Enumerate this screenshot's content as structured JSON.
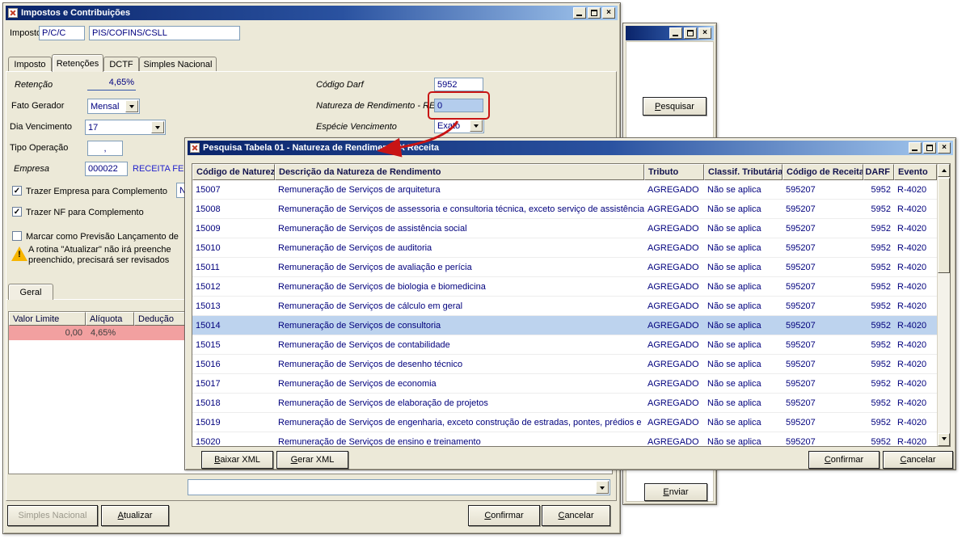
{
  "icons": {
    "close": "×",
    "check": "✓",
    "warning_mark": "!"
  },
  "colors": {
    "titlebar_start": "#0A246A",
    "titlebar_end": "#A6CAF0",
    "selected_row": "#BDD3EE",
    "limit_row": "#F2A0A0",
    "annotation_red": "#C81414",
    "field_text": "#000080"
  },
  "main_window": {
    "title": "Impostos e Contribuições",
    "imposto": {
      "label": "Imposto",
      "code": "P/C/C",
      "name": "PIS/COFINS/CSLL"
    },
    "tabs": [
      "Imposto",
      "Retenções",
      "DCTF",
      "Simples Nacional"
    ],
    "active_tab": "Retenções",
    "ret": {
      "retencao_label": "Retenção",
      "retencao_value": "4,65%",
      "fato_label": "Fato Gerador",
      "fato_value": "Mensal",
      "dia_label": "Dia Vencimento",
      "dia_value": "17",
      "tipo_label": "Tipo Operação",
      "tipo_value": ",",
      "empresa_label": "Empresa",
      "empresa_code": "000022",
      "empresa_name": "RECEITA FEDE",
      "check1": "Trazer Empresa para Complemento",
      "check1_value": "N",
      "check2": "Trazer NF para Complemento",
      "check3": "Marcar como Previsão Lançamento de",
      "warn1": "A rotina \"Atualizar\" não irá preenche",
      "warn2": "preenchido, precisará ser revisados",
      "darf_label": "Código Darf",
      "darf_value": "5952",
      "natureza_label": "Natureza de Rendimento - REINF",
      "natureza_value": "0",
      "especie_label": "Espécie Vencimento",
      "especie_value": "Exato"
    },
    "geral": {
      "tab": "Geral",
      "headers": [
        "Valor Limite",
        "Alíquota",
        "Dedução"
      ],
      "valor": "0,00",
      "aliquota": "4,65%"
    },
    "buttons": {
      "simples": "Simples Nacional",
      "atualizar": "Atualizar",
      "confirmar": "Confirmar",
      "cancelar": "Cancelar"
    }
  },
  "back_window": {
    "pesquisar": "Pesquisar",
    "enviar": "Enviar"
  },
  "popup": {
    "title": "Pesquisa Tabela 01 - Natureza de Rendimento X Receita",
    "columns": [
      "Código de Natureza",
      "Descrição da Natureza de Rendimento",
      "Tributo",
      "Classif. Tributária",
      "Código de Receita",
      "DARF",
      "Evento"
    ],
    "selected_code": "15014",
    "rows": [
      {
        "code": "15007",
        "desc": "Remuneração de Serviços de arquitetura",
        "tributo": "AGREGADO",
        "classif": "Não se aplica",
        "receita": "595207",
        "darf": "5952",
        "evento": "R-4020"
      },
      {
        "code": "15008",
        "desc": "Remuneração de Serviços de assessoria e consultoria técnica, exceto serviço de assistência técnica",
        "tributo": "AGREGADO",
        "classif": "Não se aplica",
        "receita": "595207",
        "darf": "5952",
        "evento": "R-4020"
      },
      {
        "code": "15009",
        "desc": "Remuneração de Serviços de assistência social",
        "tributo": "AGREGADO",
        "classif": "Não se aplica",
        "receita": "595207",
        "darf": "5952",
        "evento": "R-4020"
      },
      {
        "code": "15010",
        "desc": "Remuneração de Serviços de auditoria",
        "tributo": "AGREGADO",
        "classif": "Não se aplica",
        "receita": "595207",
        "darf": "5952",
        "evento": "R-4020"
      },
      {
        "code": "15011",
        "desc": "Remuneração de Serviços de avaliação e perícia",
        "tributo": "AGREGADO",
        "classif": "Não se aplica",
        "receita": "595207",
        "darf": "5952",
        "evento": "R-4020"
      },
      {
        "code": "15012",
        "desc": "Remuneração de Serviços de  biologia e biomedicina",
        "tributo": "AGREGADO",
        "classif": "Não se aplica",
        "receita": "595207",
        "darf": "5952",
        "evento": "R-4020"
      },
      {
        "code": "15013",
        "desc": "Remuneração de Serviços de cálculo em geral",
        "tributo": "AGREGADO",
        "classif": "Não se aplica",
        "receita": "595207",
        "darf": "5952",
        "evento": "R-4020"
      },
      {
        "code": "15014",
        "desc": "Remuneração de Serviços de consultoria",
        "tributo": "AGREGADO",
        "classif": "Não se aplica",
        "receita": "595207",
        "darf": "5952",
        "evento": "R-4020"
      },
      {
        "code": "15015",
        "desc": "Remuneração de Serviços de  contabilidade",
        "tributo": "AGREGADO",
        "classif": "Não se aplica",
        "receita": "595207",
        "darf": "5952",
        "evento": "R-4020"
      },
      {
        "code": "15016",
        "desc": "Remuneração de Serviços de desenho técnico",
        "tributo": "AGREGADO",
        "classif": "Não se aplica",
        "receita": "595207",
        "darf": "5952",
        "evento": "R-4020"
      },
      {
        "code": "15017",
        "desc": "Remuneração de Serviços de economia",
        "tributo": "AGREGADO",
        "classif": "Não se aplica",
        "receita": "595207",
        "darf": "5952",
        "evento": "R-4020"
      },
      {
        "code": "15018",
        "desc": "Remuneração de Serviços de elaboração de projetos",
        "tributo": "AGREGADO",
        "classif": "Não se aplica",
        "receita": "595207",
        "darf": "5952",
        "evento": "R-4020"
      },
      {
        "code": "15019",
        "desc": "Remuneração de Serviços de engenharia, exceto construção de estradas, pontes, prédios e obras",
        "tributo": "AGREGADO",
        "classif": "Não se aplica",
        "receita": "595207",
        "darf": "5952",
        "evento": "R-4020"
      },
      {
        "code": "15020",
        "desc": "Remuneração de Serviços de ensino e treinamento",
        "tributo": "AGREGADO",
        "classif": "Não se aplica",
        "receita": "595207",
        "darf": "5952",
        "evento": "R-4020"
      }
    ],
    "buttons": {
      "baixar": "Baixar XML",
      "gerar": "Gerar XML",
      "confirmar": "Confirmar",
      "cancelar": "Cancelar"
    }
  }
}
